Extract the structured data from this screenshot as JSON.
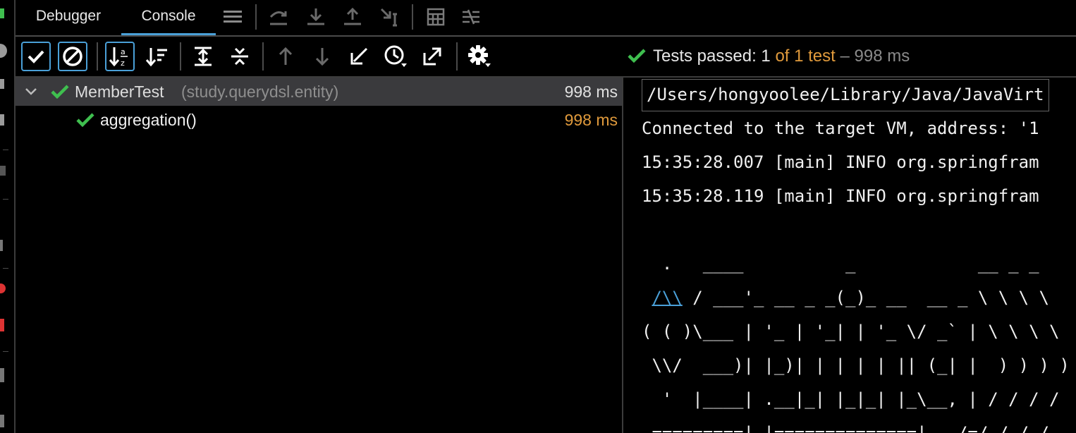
{
  "tabs": [
    {
      "label": "Debugger"
    },
    {
      "label": "Console",
      "active": true
    }
  ],
  "tab_icons": [
    "menu-icon",
    "step-over-icon",
    "step-into-icon",
    "step-out-icon",
    "run-to-cursor-icon",
    "evaluate-icon",
    "trace-icon"
  ],
  "toolbar_icons": [
    "show-passed-icon",
    "show-ignored-icon",
    "sort-alpha-icon",
    "sort-duration-icon",
    "expand-all-icon",
    "collapse-all-icon",
    "prev-failed-icon",
    "next-failed-icon",
    "import-tests-icon",
    "history-icon",
    "export-icon",
    "settings-icon"
  ],
  "status": {
    "prefix": "Tests passed: 1",
    "middle": "of 1 test",
    "suffix": "– 998 ms"
  },
  "tree": [
    {
      "name": "MemberTest",
      "detail": "(study.querydsl.entity)",
      "duration": "998 ms"
    },
    {
      "name": "aggregation()",
      "duration": "998 ms"
    }
  ],
  "console": {
    "lines": [
      "/Users/hongyoolee/Library/Java/JavaVirt",
      "Connected to the target VM, address: '1",
      "15:35:28.007 [main] INFO org.springfram",
      "15:35:28.119 [main] INFO org.springfram"
    ],
    "banner": [
      "  .   ____          _            __ _ _",
      " /\\\\ / ___'_ __ _ _(_)_ __  __ _ \\ \\ \\ \\",
      "( ( )\\___ | '_ | '_| | '_ \\/ _` | \\ \\ \\ \\",
      " \\\\/  ___)| |_)| | | | | || (_| |  ) ) ) )",
      "  '  |____| .__|_| |_|_| |_\\__, | / / / /",
      " =========|_|==============|___/=/_/_/_/"
    ],
    "link_text": "/\\\\"
  },
  "colors": {
    "accent": "#4aa0d8",
    "pass_green": "#3fbf4f",
    "duration_orange": "#e09a3c"
  }
}
